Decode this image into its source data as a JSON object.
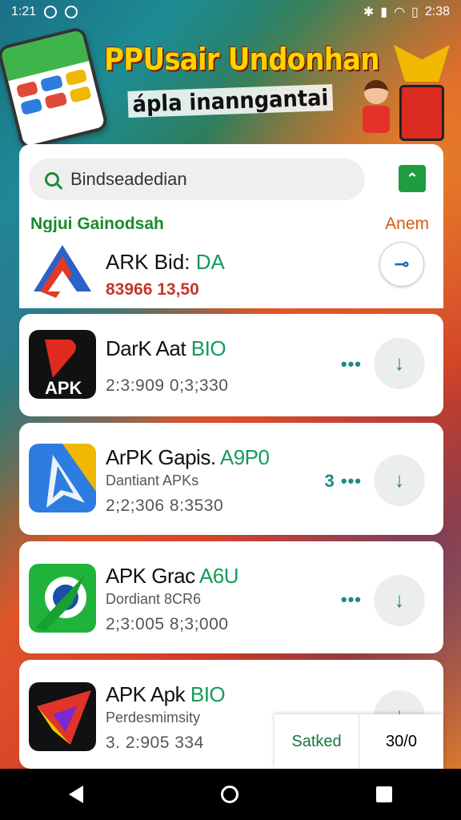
{
  "statusbar": {
    "time": "1:21",
    "clock": "2:38"
  },
  "banner": {
    "title": "PPUsair Undonhan",
    "subtitle": "ápla inanngantai"
  },
  "search": {
    "placeholder": "Bindseadedian"
  },
  "section": {
    "title": "Ngjui Gainodsah",
    "link": "Anem"
  },
  "apps": [
    {
      "name": "ARK Bid:",
      "version": "DA",
      "subtitle": "",
      "stats": "83966  13,50",
      "more": "",
      "icon": "apk-blue-triangle-icon"
    },
    {
      "name": "DarK Aat",
      "version": "BIO",
      "subtitle": "",
      "stats": "2:3:909  0;3;330",
      "more": "•••",
      "icon": "apk-black-icon"
    },
    {
      "name": "ArPK Gapis.",
      "version": "A9P0",
      "subtitle": "Dantiant APKs",
      "stats": "2;2;306  8:3530",
      "more": "3 •••",
      "icon": "apk-blue-icon"
    },
    {
      "name": "APK Grac",
      "version": "A6U",
      "subtitle": "Dordiant 8CR6",
      "stats": "2;3:005  8;3;000",
      "more": "•••",
      "icon": "apk-green-icon"
    },
    {
      "name": "APK Apk",
      "version": "BIO",
      "subtitle": "Perdesmimsity",
      "stats": "3. 2:905   334",
      "more": "",
      "icon": "apk-red-icon"
    }
  ],
  "popup": {
    "left": "Satked",
    "right": "30/0"
  },
  "colors": {
    "accent_green": "#1a8a2c",
    "version_green": "#179a5c",
    "link_orange": "#d65a10",
    "stats_red": "#c5372a"
  }
}
